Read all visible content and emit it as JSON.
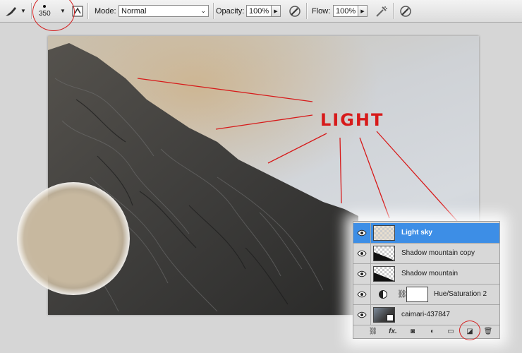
{
  "toolbar": {
    "brush_size": "350",
    "mode_label": "Mode:",
    "mode_value": "Normal",
    "opacity_label": "Opacity:",
    "opacity_value": "100%",
    "flow_label": "Flow:",
    "flow_value": "100%"
  },
  "canvas": {
    "annotation_text": "LIGHT"
  },
  "layers": [
    {
      "name": "Light sky",
      "selected": true,
      "thumb": "transparent-tan"
    },
    {
      "name": "Shadow mountain copy",
      "selected": false,
      "thumb": "transparent-dark"
    },
    {
      "name": "Shadow mountain",
      "selected": false,
      "thumb": "transparent-dark"
    },
    {
      "name": "Hue/Saturation 2",
      "selected": false,
      "thumb": "adjustment-mask"
    },
    {
      "name": "caimari-437847",
      "selected": false,
      "thumb": "photo-smart-object"
    }
  ],
  "colors": {
    "annotation_red": "#d71a1a",
    "selected_layer": "#3d8ee6",
    "brush_color": "#c7b89f"
  },
  "icons": [
    "brush-icon",
    "brush-preset-icon",
    "toggle-brush-panel-icon",
    "pressure-opacity-icon",
    "airbrush-icon",
    "pressure-size-icon",
    "eye-icon",
    "link-icon",
    "fx-icon",
    "mask-icon",
    "adjustment-icon",
    "folder-icon",
    "new-layer-icon",
    "trash-icon"
  ]
}
